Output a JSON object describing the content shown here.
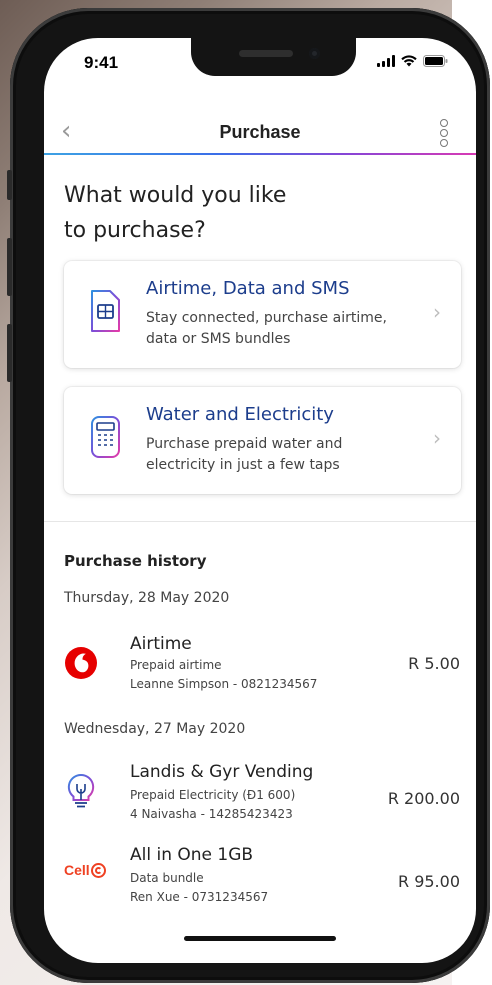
{
  "status_bar": {
    "time": "9:41"
  },
  "header": {
    "title": "Purchase",
    "back_icon": "chevron-left-icon",
    "menu_icon": "kebab-menu-icon"
  },
  "heading": {
    "line1": "What would you like",
    "line2": "to purchase?"
  },
  "options": [
    {
      "icon": "sim-card-icon",
      "title": "Airtime, Data and SMS",
      "desc_line1": "Stay connected, purchase airtime,",
      "desc_line2": "data or SMS bundles"
    },
    {
      "icon": "meter-icon",
      "title": "Water and Electricity",
      "desc_line1": "Purchase prepaid water and",
      "desc_line2": "electricity in just a few taps"
    }
  ],
  "history": {
    "title": "Purchase history",
    "groups": [
      {
        "date": "Thursday, 28 May 2020",
        "items": [
          {
            "logo": "vodafone-logo-icon",
            "name": "Airtime",
            "type": "Prepaid airtime",
            "detail": "Leanne Simpson - 0821234567",
            "amount": "R 5.00"
          }
        ]
      },
      {
        "date": "Wednesday, 27 May 2020",
        "items": [
          {
            "logo": "lightbulb-icon",
            "name": "Landis & Gyr Vending",
            "type": "Prepaid Electricity (Đ1 600)",
            "detail": "4 Naivasha - 14285423423",
            "amount": "R 200.00"
          },
          {
            "logo": "cellc-logo-icon",
            "logo_text": "Cell",
            "name": "All in One 1GB",
            "type": "Data bundle",
            "detail": "Ren Xue - 0731234567",
            "amount": "R 95.00"
          }
        ]
      }
    ]
  },
  "colors": {
    "accent_blue": "#1c3d8c",
    "vodafone_red": "#e60000",
    "cellc_orange": "#ef4123"
  }
}
